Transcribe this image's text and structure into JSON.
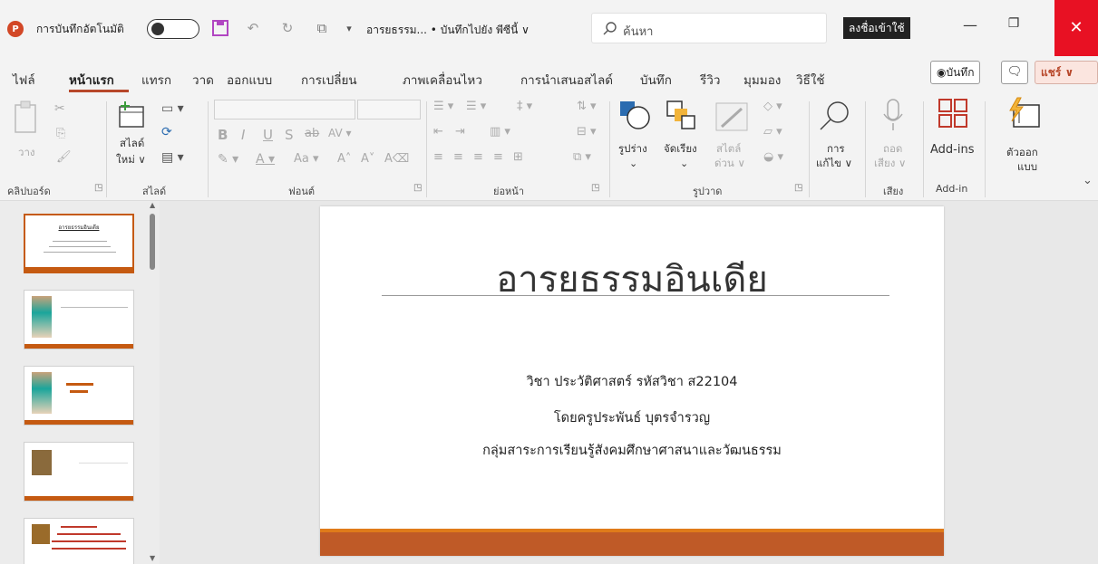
{
  "titlebar": {
    "app_logo": "P",
    "autosave_label": "การบันทึกอัตโนมัติ",
    "doc_title": "อารยธรรม... • บันทึกไปยัง พีซีนี้ ∨",
    "search_placeholder": "ค้นหา",
    "signin_label": "ลงชื่อเข้าใช้",
    "minimize": "—",
    "maximize": "❐",
    "close": "✕"
  },
  "tabs": [
    "ไฟล์",
    "หน้าแรก",
    "แทรก",
    "วาด",
    "ออกแบบ",
    "การเปลี่ยน",
    "ภาพเคลื่อนไหว",
    "การนำเสนอสไลด์",
    "บันทึก",
    "รีวิว",
    "มุมมอง",
    "วิธีใช้"
  ],
  "actions": {
    "record_label": "◉บันทึก",
    "comment_icon": "🗨",
    "share_label": "แชร์ ∨"
  },
  "ribbon": {
    "paste_label": "วาง",
    "new_slide_label_1": "สไลด์",
    "new_slide_label_2": "ใหม่ ∨",
    "shapes_label": "รูปร่าง",
    "arrange_label": "จัดเรียง",
    "quick_styles_label_1": "สไตล์",
    "quick_styles_label_2": "ด่วน ∨",
    "editing_label_1": "การ",
    "editing_label_2": "แก้ไข ∨",
    "dictate_label_1": "ถอด",
    "dictate_label_2": "เสียง ∨",
    "addins_label": "Add-ins",
    "designer_label_1": "ตัวออก",
    "designer_label_2": "แบบ",
    "groups": {
      "clipboard": "คลิปบอร์ด",
      "slides": "สไลด์",
      "font": "ฟอนต์",
      "paragraph": "ย่อหน้า",
      "drawing": "รูปวาด",
      "voice": "เสียง",
      "addin": "Add-in"
    }
  },
  "slide": {
    "title": "อารยธรรมอินเดีย",
    "line1": "วิชา ประวัติศาสตร์ รหัสวิชา ส22104",
    "line2": "โดยครูประพันธ์ บุตรจำรวญ",
    "line3": "กลุ่มสาระการเรียนรู้สังคมศึกษาศาสนาและวัฒนธรรม"
  },
  "thumbnails": {
    "slide1_title": "อารยธรรมอินเดีย"
  },
  "colors": {
    "accent": "#b7472a",
    "slide_bar": "#bf5a27",
    "slide_bar_top": "#e07b1a",
    "close_red": "#e81123"
  }
}
